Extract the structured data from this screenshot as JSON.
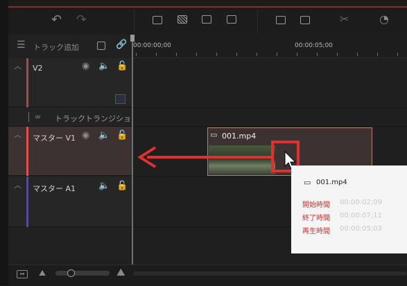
{
  "toolbar": {
    "buttons": [
      "undo-icon",
      "redo-icon",
      "add-marker-icon",
      "freeze-icon",
      "split-left-icon",
      "split-right-icon",
      "delete-icon",
      "ripple-delete-icon",
      "scissors-icon",
      "speed-icon"
    ]
  },
  "track_panel": {
    "add_track_label": "トラック追加",
    "tracks": [
      {
        "name": "V2"
      },
      {
        "name": "トラックトランジション"
      },
      {
        "name": "マスター V1"
      },
      {
        "name": "マスター A1"
      }
    ]
  },
  "ruler": {
    "start": "00:00:00;00",
    "mark": "00:00:05;00"
  },
  "clip": {
    "name": "001.mp4"
  },
  "tooltip": {
    "name": "001.mp4",
    "start_label": "開始時間",
    "start_value": "00:00:02;09",
    "end_label": "終了時間",
    "end_value": "00:00:07;11",
    "duration_label": "再生時間",
    "duration_value": "00:00:05;03"
  },
  "colors": {
    "accent_red": "#e03030",
    "v_track_bar": "#8a5656",
    "a_track_bar": "#5a4a9a"
  },
  "zoom": {
    "slider_value": 0.1
  }
}
